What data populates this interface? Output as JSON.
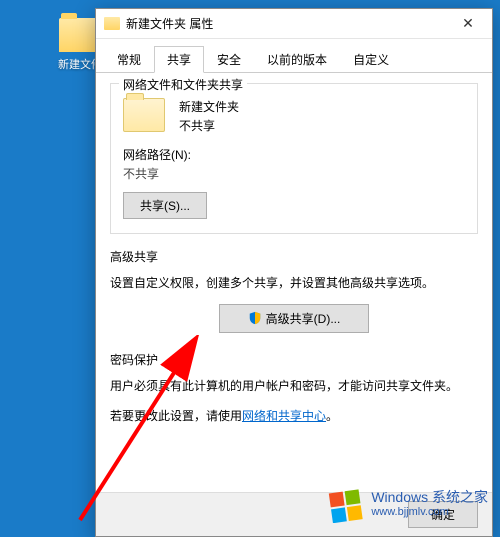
{
  "desktop": {
    "icon_label": "新建文件"
  },
  "dialog": {
    "title": "新建文件夹 属性",
    "tabs": {
      "general": "常规",
      "share": "共享",
      "security": "安全",
      "previous": "以前的版本",
      "custom": "自定义"
    },
    "share_group": {
      "title": "网络文件和文件夹共享",
      "folder_name": "新建文件夹",
      "share_status": "不共享",
      "path_label": "网络路径(N):",
      "path_value": "不共享",
      "share_button": "共享(S)..."
    },
    "advanced_group": {
      "title": "高级共享",
      "description": "设置自定义权限，创建多个共享，并设置其他高级共享选项。",
      "button": "高级共享(D)..."
    },
    "password_group": {
      "title": "密码保护",
      "description": "用户必须具有此计算机的用户帐户和密码，才能访问共享文件夹。",
      "change_prefix": "若要更改此设置，请使用",
      "link_text": "网络和共享中心",
      "change_suffix": "。"
    },
    "footer": {
      "ok": "确定"
    }
  },
  "watermark": {
    "line1": "Windows 系统之家",
    "line2": "www.bjjmlv.com"
  }
}
